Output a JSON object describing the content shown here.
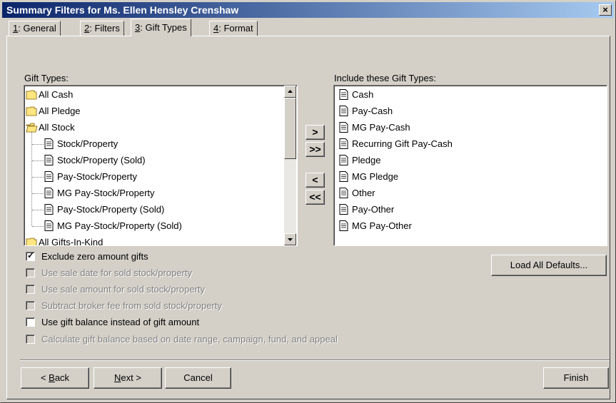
{
  "window": {
    "title": "Summary Filters for Ms. Ellen Hensley Crenshaw",
    "close_label": "×"
  },
  "tabs": [
    {
      "num": "1",
      "rest": ": General"
    },
    {
      "num": "2",
      "rest": ": Filters"
    },
    {
      "num": "3",
      "rest": ": Gift Types"
    },
    {
      "num": "4",
      "rest": ": Format"
    }
  ],
  "active_tab": 2,
  "gift_types": {
    "label": "Gift Types:",
    "items": [
      {
        "label": "All Cash",
        "kind": "folder",
        "icon": "folder-icon"
      },
      {
        "label": "All Pledge",
        "kind": "folder",
        "icon": "folder-icon"
      },
      {
        "label": "All Stock",
        "kind": "folder",
        "icon": "open-folder-icon"
      },
      {
        "label": "Stock/Property",
        "kind": "child",
        "icon": "document-icon"
      },
      {
        "label": "Stock/Property (Sold)",
        "kind": "child",
        "icon": "document-icon"
      },
      {
        "label": "Pay-Stock/Property",
        "kind": "child",
        "icon": "document-icon"
      },
      {
        "label": "MG Pay-Stock/Property",
        "kind": "child",
        "icon": "document-icon"
      },
      {
        "label": "Pay-Stock/Property (Sold)",
        "kind": "child",
        "icon": "document-icon"
      },
      {
        "label": "MG Pay-Stock/Property (Sold)",
        "kind": "child",
        "icon": "document-icon"
      },
      {
        "label": "All Gifts-In-Kind",
        "kind": "folder",
        "icon": "folder-icon"
      }
    ]
  },
  "include_types": {
    "label": "Include these Gift Types:",
    "items": [
      "Cash",
      "Pay-Cash",
      "MG Pay-Cash",
      "Recurring Gift Pay-Cash",
      "Pledge",
      "MG Pledge",
      "Other",
      "Pay-Other",
      "MG Pay-Other"
    ]
  },
  "move_buttons": {
    "add": ">",
    "add_all": ">>",
    "remove": "<",
    "remove_all": "<<"
  },
  "options": [
    {
      "label": "Exclude zero amount gifts",
      "checked": true,
      "enabled": true
    },
    {
      "label": "Use sale date for sold stock/property",
      "checked": false,
      "enabled": false
    },
    {
      "label": "Use sale amount for sold stock/property",
      "checked": false,
      "enabled": false
    },
    {
      "label": "Subtract broker fee from sold stock/property",
      "checked": false,
      "enabled": false
    },
    {
      "label": "Use gift balance instead of gift amount",
      "checked": false,
      "enabled": true
    },
    {
      "label": "Calculate gift balance based on date range, campaign, fund, and appeal",
      "checked": false,
      "enabled": false
    }
  ],
  "load_defaults_label": "Load All Defaults...",
  "footer": {
    "back_pre": "< ",
    "back_key": "B",
    "back_post": "ack",
    "next_key": "N",
    "next_post": "ext >",
    "cancel_label": "Cancel",
    "finish_label": "Finish"
  },
  "colors": {
    "titlebar_start": "#0a246a",
    "titlebar_end": "#a6caf0",
    "face": "#d4d0c8",
    "folder": "#ffe680"
  }
}
